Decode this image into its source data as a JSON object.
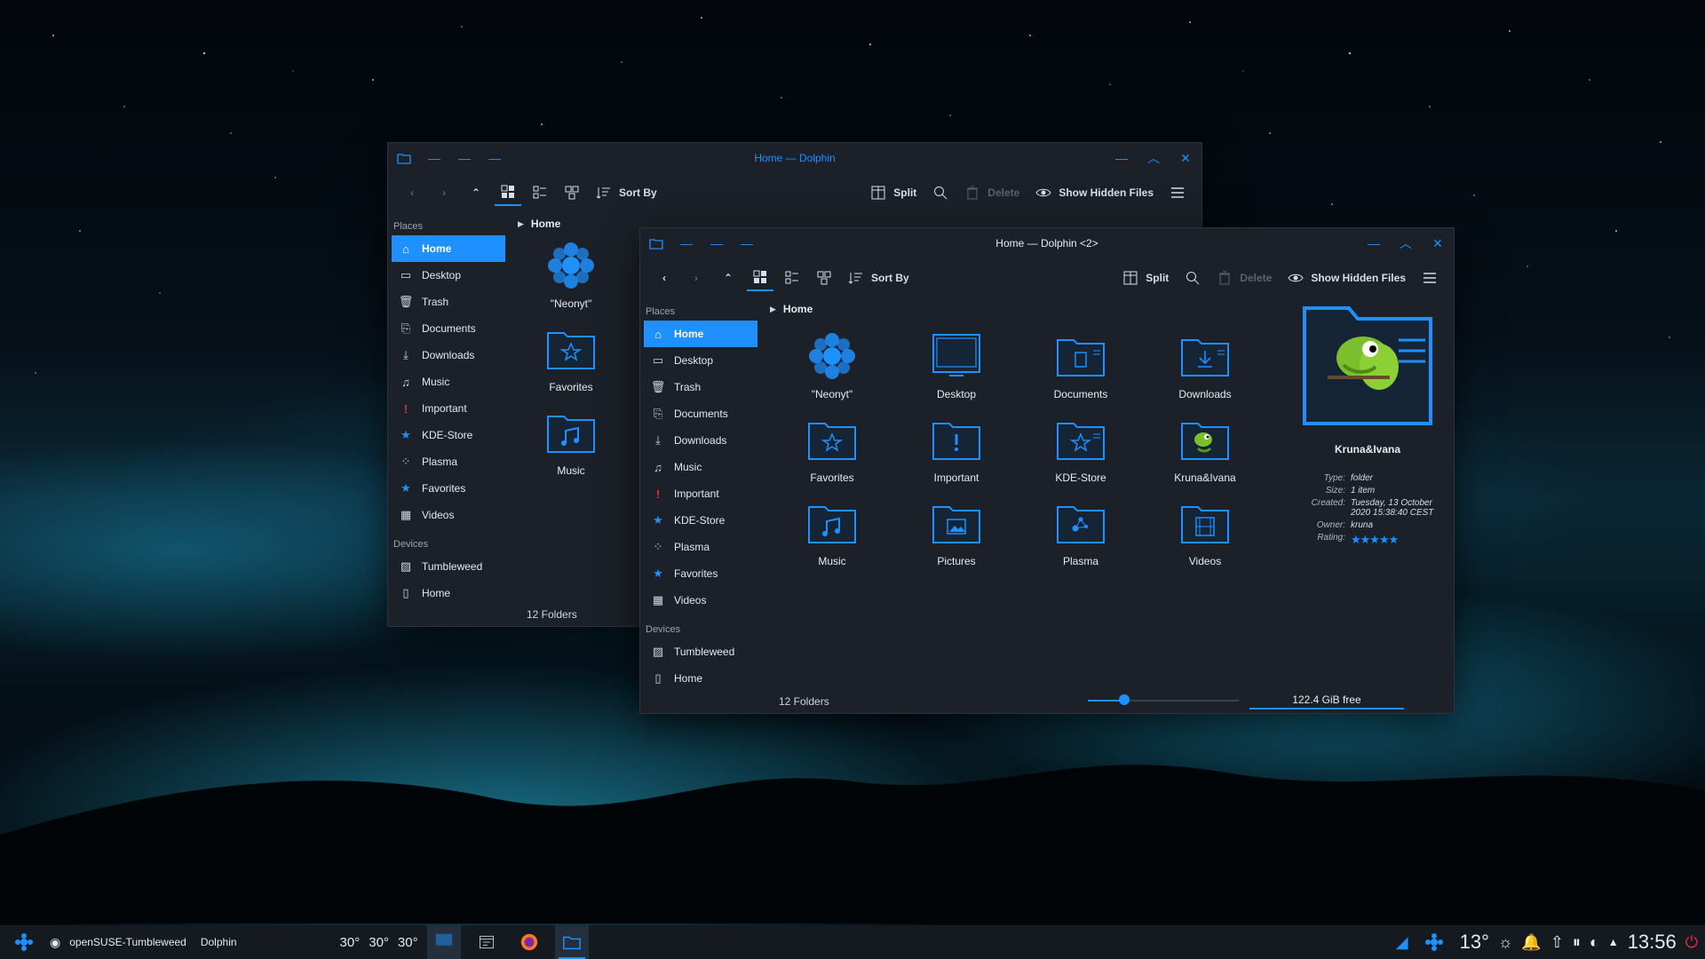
{
  "colors": {
    "accent": "#1e90ff",
    "window_bg": "#1c2129",
    "danger": "#e0323c"
  },
  "window_back": {
    "title": "Home — Dolphin",
    "toolbar": {
      "sort_by": "Sort By",
      "split": "Split",
      "delete": "Delete",
      "show_hidden": "Show Hidden Files"
    },
    "places_header": "Places",
    "places": [
      "Home",
      "Desktop",
      "Trash",
      "Documents",
      "Downloads",
      "Music",
      "Important",
      "KDE-Store",
      "Plasma",
      "Favorites",
      "Videos"
    ],
    "devices_header": "Devices",
    "devices": [
      "Tumbleweed",
      "Home"
    ],
    "breadcrumb": "Home",
    "items": [
      "\"Neonyt\"",
      "Favorites",
      "Music"
    ],
    "status": "12 Folders"
  },
  "window_front": {
    "title": "Home — Dolphin <2>",
    "toolbar": {
      "sort_by": "Sort By",
      "split": "Split",
      "delete": "Delete",
      "show_hidden": "Show Hidden Files"
    },
    "places_header": "Places",
    "places": [
      "Home",
      "Desktop",
      "Trash",
      "Documents",
      "Downloads",
      "Music",
      "Important",
      "KDE-Store",
      "Plasma",
      "Favorites",
      "Videos"
    ],
    "devices_header": "Devices",
    "devices": [
      "Tumbleweed",
      "Home"
    ],
    "breadcrumb": "Home",
    "items": [
      "\"Neonyt\"",
      "Desktop",
      "Documents",
      "Downloads",
      "Favorites",
      "Important",
      "KDE-Store",
      "Kruna&Ivana",
      "Music",
      "Pictures",
      "Plasma",
      "Videos"
    ],
    "status": "12 Folders",
    "zoom_level": 0.24,
    "free_space": "122.4 GiB free",
    "info": {
      "name": "Kruna&Ivana",
      "type_label": "Type:",
      "type": "folder",
      "size_label": "Size:",
      "size": "1 item",
      "created_label": "Created:",
      "created": "Tuesday, 13 October 2020 15:38:40 CEST",
      "owner_label": "Owner:",
      "owner": "kruna",
      "rating_label": "Rating:",
      "rating": 5
    }
  },
  "taskbar": {
    "activity": "openSUSE-Tumbleweed",
    "app": "Dolphin",
    "temps": [
      "30°",
      "30°",
      "30°"
    ],
    "weather": "13°",
    "clock": "13:56"
  }
}
